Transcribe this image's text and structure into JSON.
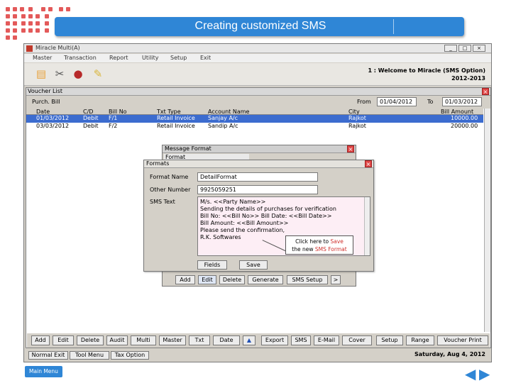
{
  "slide": {
    "title": "Creating customized SMS",
    "main_menu_label": "Main Menu"
  },
  "app": {
    "window_title": "Miracle Multi(A)",
    "menu": [
      "Master",
      "Transaction",
      "Report",
      "Utility",
      "Setup",
      "Exit"
    ],
    "welcome_line1": "1 : Welcome to Miracle (SMS Option)",
    "welcome_line2": "2012-2013"
  },
  "voucher_list": {
    "title": "Voucher List",
    "filter_label": "Purch. Bill",
    "from_label": "From",
    "from_date": "01/04/2012",
    "to_label": "To",
    "to_date": "01/03/2012",
    "columns": [
      "Date",
      "C/D",
      "Bill No",
      "Txt Type",
      "Account Name",
      "City",
      "Bill Amount"
    ],
    "rows": [
      [
        "01/03/2012",
        "Debit",
        "F/1",
        "Retail Invoice",
        "Sanjay A/c",
        "Rajkot",
        "10000.00"
      ],
      [
        "03/03/2012",
        "Debit",
        "F/2",
        "Retail Invoice",
        "Sandip A/c",
        "Rajkot",
        "20000.00"
      ]
    ],
    "bottom_buttons": [
      "Add",
      "Edit",
      "Delete",
      "Audit",
      "Multi",
      "Master",
      "Txt",
      "Date",
      "Export",
      "SMS",
      "E-Mail",
      "Cover",
      "Setup",
      "Range",
      "Voucher Print"
    ]
  },
  "status_bar": {
    "tabs": [
      "Normal Exit",
      "Tool Menu",
      "Tax Option"
    ],
    "date": "Saturday, Aug 4, 2012"
  },
  "message_format": {
    "title": "Message Format",
    "subtitle": "Format",
    "buttons": [
      "Add",
      "Edit",
      "Delete",
      "Generate",
      "SMS Setup",
      ">"
    ]
  },
  "formats": {
    "title": "Formats",
    "format_name_label": "Format Name",
    "format_name_value": "DetailFormat",
    "other_number_label": "Other Number",
    "other_number_value": "9925059251",
    "sms_text_label": "SMS Text",
    "sms_lines": [
      "M/s. <<Party Name>>",
      "Sending the details of purchases for verification",
      "Bill No: <<Bill No>> Bill Date: <<Bill Date>>",
      "Bill Amount: <<Bill Amount>>",
      "Please send the confirmation,",
      "R.K. Softwares"
    ],
    "fields_button": "Fields",
    "save_button": "Save"
  },
  "callout": {
    "line1_prefix": "Click here to ",
    "line1_highlight": "Save",
    "line2_prefix": "the new ",
    "line2_highlight": "SMS Format"
  }
}
